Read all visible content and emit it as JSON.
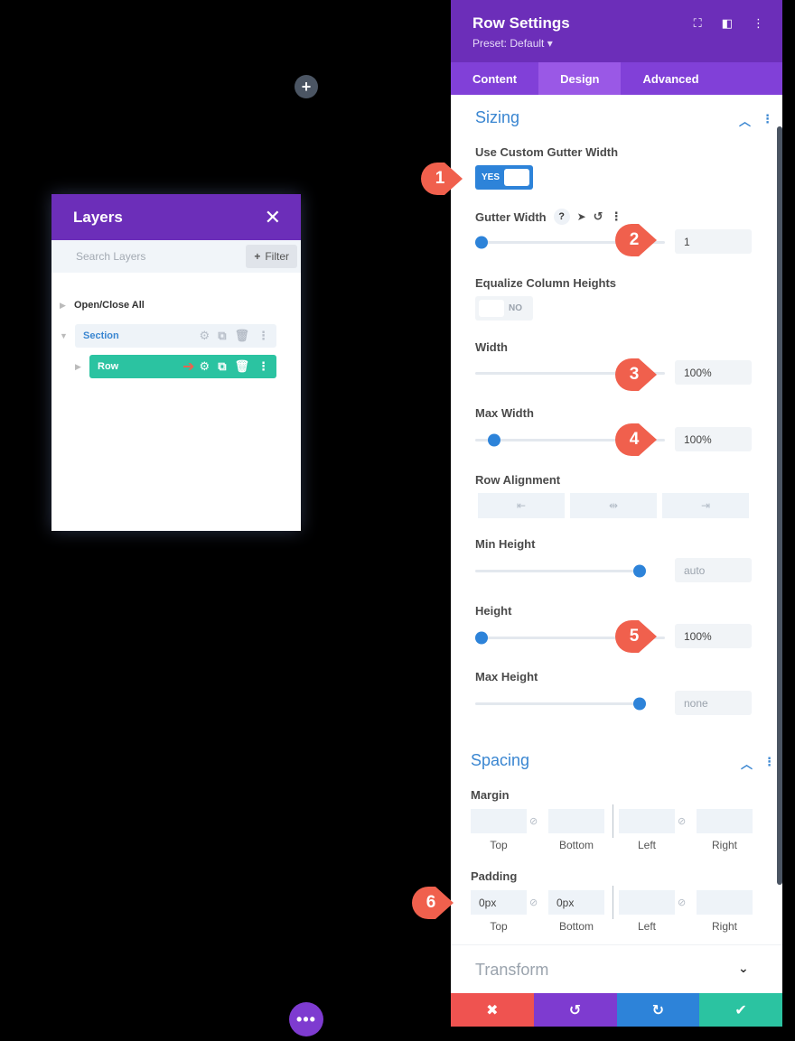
{
  "canvas": {
    "add_symbol": "+",
    "more_symbol": "•••"
  },
  "layers": {
    "title": "Layers",
    "close_symbol": "✕",
    "search_placeholder": "Search Layers",
    "filter_label": "Filter",
    "open_close_all": "Open/Close All",
    "section_label": "Section",
    "row_label": "Row"
  },
  "settings": {
    "title": "Row Settings",
    "preset": "Preset: Default ▾",
    "tabs": [
      "Content",
      "Design",
      "Advanced"
    ],
    "active_tab": "Design",
    "sizing": {
      "title": "Sizing",
      "use_custom_gutter_label": "Use Custom Gutter Width",
      "use_custom_gutter_value": "YES",
      "gutter_width_label": "Gutter Width",
      "gutter_width_value": "1",
      "gutter_width_fraction": 0.0,
      "equalize_label": "Equalize Column Heights",
      "equalize_value": "NO",
      "width_label": "Width",
      "width_value": "100%",
      "max_width_label": "Max Width",
      "max_width_value": "100%",
      "max_width_fraction": 0.07,
      "row_alignment_label": "Row Alignment",
      "min_height_label": "Min Height",
      "min_height_value": "auto",
      "min_height_fraction": 1.0,
      "height_label": "Height",
      "height_value": "100%",
      "height_fraction": 0.0,
      "max_height_label": "Max Height",
      "max_height_value": "none",
      "max_height_fraction": 1.0
    },
    "spacing": {
      "title": "Spacing",
      "margin_label": "Margin",
      "padding_label": "Padding",
      "side_labels": [
        "Top",
        "Bottom",
        "Left",
        "Right"
      ],
      "padding_values": [
        "0px",
        "0px",
        "",
        ""
      ]
    },
    "transform": {
      "title": "Transform"
    },
    "footer_colors": [
      "#ef5350",
      "#7e3bd0",
      "#2d83d9",
      "#2bc3a1"
    ]
  },
  "markers": [
    "1",
    "2",
    "3",
    "4",
    "5",
    "6"
  ],
  "colors": {
    "purple_header": "#6c2eb9",
    "accent_blue": "#2d83d9",
    "teal": "#2bc3a1",
    "marker_red": "#f0604d"
  }
}
